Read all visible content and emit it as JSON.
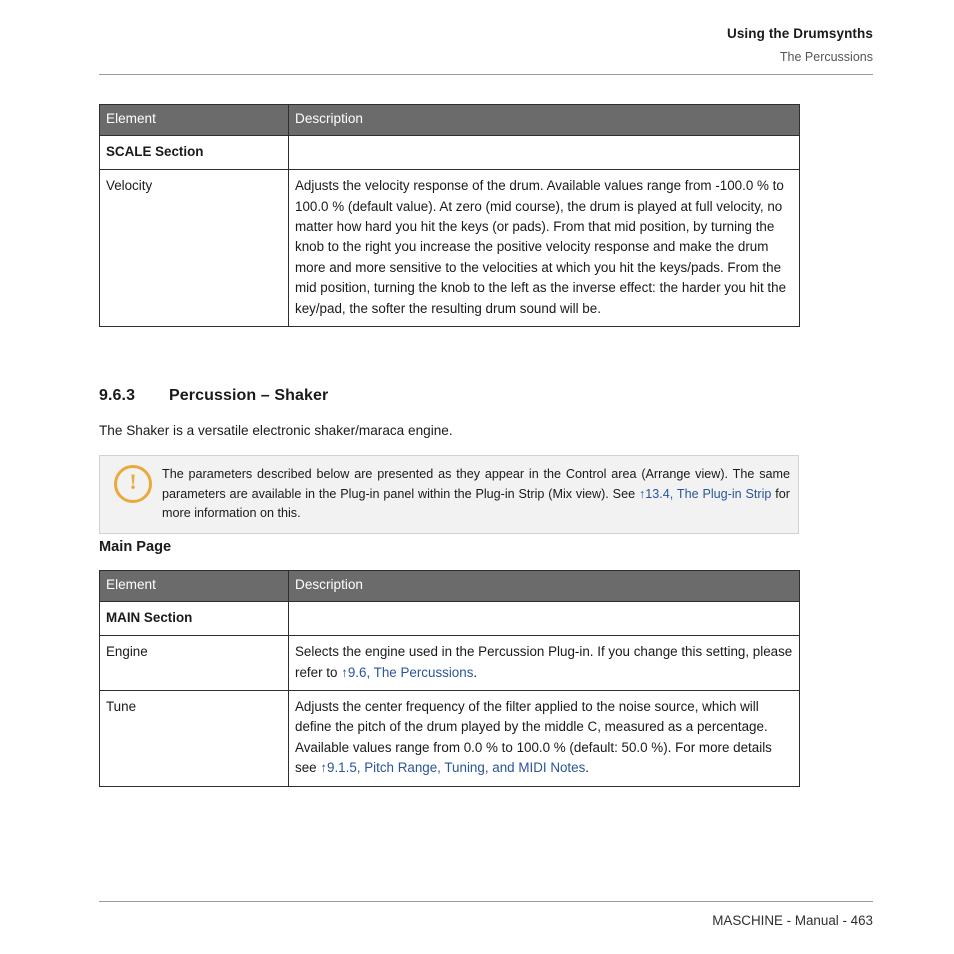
{
  "header": {
    "chapter_title": "Using the Drumsynths",
    "section_title": "The Percussions"
  },
  "table_top": {
    "columns": [
      "Element",
      "Description"
    ],
    "rows": [
      {
        "type": "section",
        "element": "SCALE Section",
        "description": ""
      },
      {
        "type": "param",
        "element": "Velocity",
        "description": "Adjusts the velocity response of the drum. Available values range from -100.0 % to 100.0 % (default value). At zero (mid course), the drum is played at full velocity, no matter how hard you hit the keys (or pads). From that mid position, by turning the knob to the right you increase the positive velocity response and make the drum more and more sensitive to the velocities at which you hit the keys/pads. From the mid position, turning the knob to the left as the inverse effect: the harder you hit the key/pad, the softer the resulting drum sound will be."
      }
    ]
  },
  "section": {
    "number": "9.6.3",
    "title": "Percussion – Shaker",
    "intro": "The Shaker is a versatile electronic shaker/maraca engine."
  },
  "callout": {
    "icon": "warning-circle-icon",
    "text_before_link": "The parameters described below are presented as they appear in the Control area (Arrange view). The same parameters are available in the Plug-in panel within the Plug-in Strip (Mix view). See ",
    "link_text": "↑13.4, The Plug-in Strip",
    "text_after_link": " for more information on this."
  },
  "subheading": "Main Page",
  "table_main": {
    "columns": [
      "Element",
      "Description"
    ],
    "rows": [
      {
        "type": "section",
        "element": "MAIN Section",
        "description": ""
      },
      {
        "type": "param",
        "element": "Engine",
        "desc_before_link": "Selects the engine used in the Percussion Plug-in. If you change this setting, please refer to ",
        "link_text": "↑9.6, The Percussions",
        "desc_after_link": "."
      },
      {
        "type": "param",
        "element": "Tune",
        "desc_before_link": "Adjusts the center frequency of the filter applied to the noise source, which will define the pitch of the drum played by the middle C, measured as a percentage. Available values range from 0.0 % to 100.0 % (default: 50.0 %). For more details see ",
        "link_text": "↑9.1.5, Pitch Range, Tuning, and MIDI Notes",
        "desc_after_link": "."
      }
    ]
  },
  "footer": {
    "text": "MASCHINE - Manual - 463"
  },
  "colors": {
    "table_header_bg": "#6b6b6b",
    "table_border": "#2e2e2e",
    "element_link": "#6786ad",
    "inline_link": "#2a5599",
    "callout_bg": "#f2f2f2",
    "callout_border": "#d2d2d2",
    "callout_icon": "#eaa93d",
    "rule": "#9a9a9a"
  }
}
